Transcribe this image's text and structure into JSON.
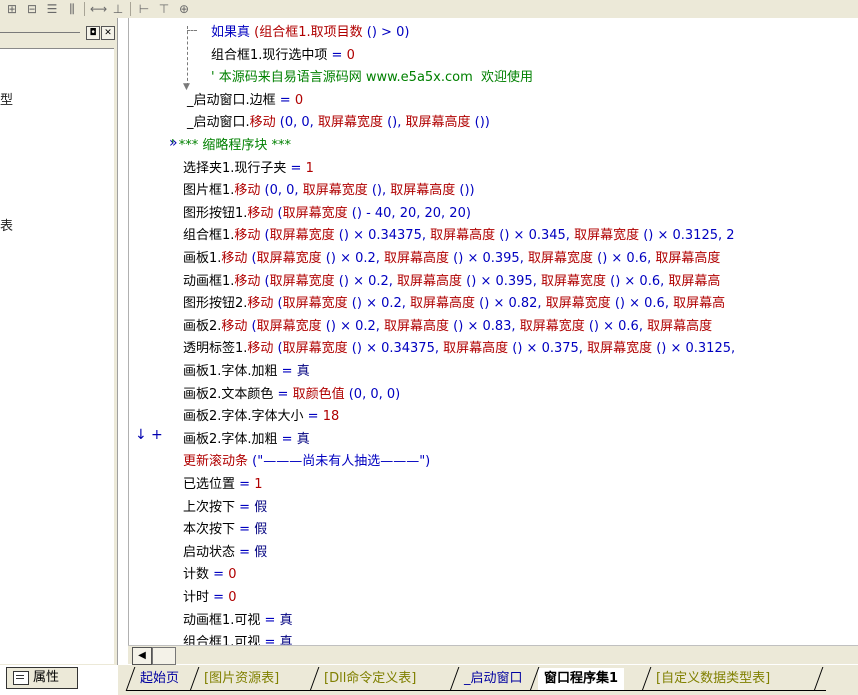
{
  "toolbar": {
    "icons": [
      "align-left-icon",
      "align-center-icon",
      "align-top-icon",
      "align-middle-icon",
      "distribute-h-icon",
      "distribute-v-icon",
      "same-width-icon",
      "same-height-icon",
      "same-size-icon"
    ],
    "glyphs": [
      "⊞",
      "⊟",
      "☰",
      "⫼",
      "⟷",
      "⊥",
      "⊢",
      "⊤",
      "⊕"
    ]
  },
  "left_panel": {
    "fragments": [
      "型",
      "表"
    ],
    "buttons": {
      "minimize": "◘",
      "close": "✕"
    }
  },
  "property_tab": {
    "label": "属性"
  },
  "editor": {
    "fold_marker": "»",
    "lines": [
      {
        "segs": [
          {
            "t": "如果真 ",
            "c": "c-blue"
          },
          {
            "t": "(组合框1.",
            "c": "c-red"
          },
          {
            "t": "取项目数",
            "c": "c-red"
          },
          {
            "t": " () > 0)",
            "c": "c-blue"
          }
        ]
      },
      {
        "segs": [
          {
            "t": "组合框1.现行选中项",
            "c": "c-black"
          },
          {
            "t": " = ",
            "c": "c-blue"
          },
          {
            "t": "0",
            "c": "c-red"
          }
        ]
      },
      {
        "segs": [
          {
            "t": "' 本源码来自易语言源码网 www.e5a5x.com  欢迎使用",
            "c": "c-green"
          }
        ]
      },
      {
        "segs": [
          {
            "t": "_启动窗口.边框",
            "c": "c-black"
          },
          {
            "t": " = ",
            "c": "c-blue"
          },
          {
            "t": "0",
            "c": "c-red"
          }
        ]
      },
      {
        "segs": [
          {
            "t": "_启动窗口.",
            "c": "c-black"
          },
          {
            "t": "移动",
            "c": "c-red"
          },
          {
            "t": " (0, 0, ",
            "c": "c-blue"
          },
          {
            "t": "取屏幕宽度",
            "c": "c-red"
          },
          {
            "t": " (), ",
            "c": "c-blue"
          },
          {
            "t": "取屏幕高度",
            "c": "c-red"
          },
          {
            "t": " ())",
            "c": "c-blue"
          }
        ]
      },
      {
        "segs": [
          {
            "t": "' *** 缩略程序块 ***",
            "c": "c-green"
          }
        ]
      },
      {
        "segs": [
          {
            "t": "选择夹1.现行子夹",
            "c": "c-black"
          },
          {
            "t": " = ",
            "c": "c-blue"
          },
          {
            "t": "1",
            "c": "c-red"
          }
        ]
      },
      {
        "segs": [
          {
            "t": "图片框1.",
            "c": "c-black"
          },
          {
            "t": "移动",
            "c": "c-red"
          },
          {
            "t": " (0, 0, ",
            "c": "c-blue"
          },
          {
            "t": "取屏幕宽度",
            "c": "c-red"
          },
          {
            "t": " (), ",
            "c": "c-blue"
          },
          {
            "t": "取屏幕高度",
            "c": "c-red"
          },
          {
            "t": " ())",
            "c": "c-blue"
          }
        ]
      },
      {
        "segs": [
          {
            "t": "图形按钮1.",
            "c": "c-black"
          },
          {
            "t": "移动",
            "c": "c-red"
          },
          {
            "t": " (",
            "c": "c-blue"
          },
          {
            "t": "取屏幕宽度",
            "c": "c-red"
          },
          {
            "t": " () - 40, 20, 20, 20)",
            "c": "c-blue"
          }
        ]
      },
      {
        "segs": [
          {
            "t": "组合框1.",
            "c": "c-black"
          },
          {
            "t": "移动",
            "c": "c-red"
          },
          {
            "t": " (",
            "c": "c-blue"
          },
          {
            "t": "取屏幕宽度",
            "c": "c-red"
          },
          {
            "t": " () × 0.34375, ",
            "c": "c-blue"
          },
          {
            "t": "取屏幕高度",
            "c": "c-red"
          },
          {
            "t": " () × 0.345, ",
            "c": "c-blue"
          },
          {
            "t": "取屏幕宽度",
            "c": "c-red"
          },
          {
            "t": " () × 0.3125, 2",
            "c": "c-blue"
          }
        ]
      },
      {
        "segs": [
          {
            "t": "画板1.",
            "c": "c-black"
          },
          {
            "t": "移动",
            "c": "c-red"
          },
          {
            "t": " (",
            "c": "c-blue"
          },
          {
            "t": "取屏幕宽度",
            "c": "c-red"
          },
          {
            "t": " () × 0.2, ",
            "c": "c-blue"
          },
          {
            "t": "取屏幕高度",
            "c": "c-red"
          },
          {
            "t": " () × 0.395, ",
            "c": "c-blue"
          },
          {
            "t": "取屏幕宽度",
            "c": "c-red"
          },
          {
            "t": " () × 0.6, ",
            "c": "c-blue"
          },
          {
            "t": "取屏幕高度",
            "c": "c-red"
          }
        ]
      },
      {
        "segs": [
          {
            "t": "动画框1.",
            "c": "c-black"
          },
          {
            "t": "移动",
            "c": "c-red"
          },
          {
            "t": " (",
            "c": "c-blue"
          },
          {
            "t": "取屏幕宽度",
            "c": "c-red"
          },
          {
            "t": " () × 0.2, ",
            "c": "c-blue"
          },
          {
            "t": "取屏幕高度",
            "c": "c-red"
          },
          {
            "t": " () × 0.395, ",
            "c": "c-blue"
          },
          {
            "t": "取屏幕宽度",
            "c": "c-red"
          },
          {
            "t": " () × 0.6, ",
            "c": "c-blue"
          },
          {
            "t": "取屏幕高",
            "c": "c-red"
          }
        ]
      },
      {
        "segs": [
          {
            "t": "图形按钮2.",
            "c": "c-black"
          },
          {
            "t": "移动",
            "c": "c-red"
          },
          {
            "t": " (",
            "c": "c-blue"
          },
          {
            "t": "取屏幕宽度",
            "c": "c-red"
          },
          {
            "t": " () × 0.2, ",
            "c": "c-blue"
          },
          {
            "t": "取屏幕高度",
            "c": "c-red"
          },
          {
            "t": " () × 0.82, ",
            "c": "c-blue"
          },
          {
            "t": "取屏幕宽度",
            "c": "c-red"
          },
          {
            "t": " () × 0.6, ",
            "c": "c-blue"
          },
          {
            "t": "取屏幕高",
            "c": "c-red"
          }
        ]
      },
      {
        "segs": [
          {
            "t": "画板2.",
            "c": "c-black"
          },
          {
            "t": "移动",
            "c": "c-red"
          },
          {
            "t": " (",
            "c": "c-blue"
          },
          {
            "t": "取屏幕宽度",
            "c": "c-red"
          },
          {
            "t": " () × 0.2, ",
            "c": "c-blue"
          },
          {
            "t": "取屏幕高度",
            "c": "c-red"
          },
          {
            "t": " () × 0.83, ",
            "c": "c-blue"
          },
          {
            "t": "取屏幕宽度",
            "c": "c-red"
          },
          {
            "t": " () × 0.6, ",
            "c": "c-blue"
          },
          {
            "t": "取屏幕高度",
            "c": "c-red"
          }
        ]
      },
      {
        "segs": [
          {
            "t": "透明标签1.",
            "c": "c-black"
          },
          {
            "t": "移动",
            "c": "c-red"
          },
          {
            "t": " (",
            "c": "c-blue"
          },
          {
            "t": "取屏幕宽度",
            "c": "c-red"
          },
          {
            "t": " () × 0.34375, ",
            "c": "c-blue"
          },
          {
            "t": "取屏幕高度",
            "c": "c-red"
          },
          {
            "t": " () × 0.375, ",
            "c": "c-blue"
          },
          {
            "t": "取屏幕宽度",
            "c": "c-red"
          },
          {
            "t": " () × 0.3125,",
            "c": "c-blue"
          }
        ]
      },
      {
        "segs": [
          {
            "t": "画板1.字体.加粗",
            "c": "c-black"
          },
          {
            "t": " = ",
            "c": "c-blue"
          },
          {
            "t": "真",
            "c": "c-navy"
          }
        ]
      },
      {
        "segs": [
          {
            "t": "画板2.文本颜色",
            "c": "c-black"
          },
          {
            "t": " = ",
            "c": "c-blue"
          },
          {
            "t": "取颜色值",
            "c": "c-red"
          },
          {
            "t": " (0, 0, 0)",
            "c": "c-blue"
          }
        ]
      },
      {
        "segs": [
          {
            "t": "画板2.字体.字体大小",
            "c": "c-black"
          },
          {
            "t": " = ",
            "c": "c-blue"
          },
          {
            "t": "18",
            "c": "c-red"
          }
        ]
      },
      {
        "segs": [
          {
            "t": "画板2.字体.加粗",
            "c": "c-black"
          },
          {
            "t": " = ",
            "c": "c-blue"
          },
          {
            "t": "真",
            "c": "c-navy"
          }
        ]
      },
      {
        "segs": [
          {
            "t": "更新滚动条",
            "c": "c-red"
          },
          {
            "t": " (\"———尚未有人抽选———\")",
            "c": "c-blue"
          }
        ]
      },
      {
        "segs": [
          {
            "t": "已选位置",
            "c": "c-black"
          },
          {
            "t": " = ",
            "c": "c-blue"
          },
          {
            "t": "1",
            "c": "c-red"
          }
        ]
      },
      {
        "segs": [
          {
            "t": "上次按下",
            "c": "c-black"
          },
          {
            "t": " = ",
            "c": "c-blue"
          },
          {
            "t": "假",
            "c": "c-navy"
          }
        ]
      },
      {
        "segs": [
          {
            "t": "本次按下",
            "c": "c-black"
          },
          {
            "t": " = ",
            "c": "c-blue"
          },
          {
            "t": "假",
            "c": "c-navy"
          }
        ]
      },
      {
        "segs": [
          {
            "t": "启动状态",
            "c": "c-black"
          },
          {
            "t": " = ",
            "c": "c-blue"
          },
          {
            "t": "假",
            "c": "c-navy"
          }
        ]
      },
      {
        "segs": [
          {
            "t": "计数",
            "c": "c-black"
          },
          {
            "t": " = ",
            "c": "c-blue"
          },
          {
            "t": "0",
            "c": "c-red"
          }
        ]
      },
      {
        "segs": [
          {
            "t": "计时",
            "c": "c-black"
          },
          {
            "t": " = ",
            "c": "c-blue"
          },
          {
            "t": "0",
            "c": "c-red"
          }
        ]
      },
      {
        "segs": [
          {
            "t": "动画框1.可视",
            "c": "c-black"
          },
          {
            "t": " = ",
            "c": "c-blue"
          },
          {
            "t": "真",
            "c": "c-navy"
          }
        ]
      },
      {
        "segs": [
          {
            "t": "组合框1.可视",
            "c": "c-black"
          },
          {
            "t": " = ",
            "c": "c-blue"
          },
          {
            "t": "真",
            "c": "c-navy"
          }
        ]
      }
    ],
    "gutter_marks": {
      "arrow": "↓",
      "plus": "+"
    }
  },
  "scrollbar": {
    "left_arrow": "◀"
  },
  "tabs": [
    {
      "label": "起始页",
      "color": "#0000a0",
      "active": false
    },
    {
      "label": "[图片资源表]",
      "color": "#808000",
      "active": false
    },
    {
      "label": "[Dll命令定义表]",
      "color": "#808000",
      "active": false
    },
    {
      "label": "_启动窗口",
      "color": "#0000a0",
      "active": false
    },
    {
      "label": "窗口程序集1",
      "color": "#000000",
      "active": true
    },
    {
      "label": "[自定义数据类型表]",
      "color": "#808000",
      "active": false
    }
  ]
}
